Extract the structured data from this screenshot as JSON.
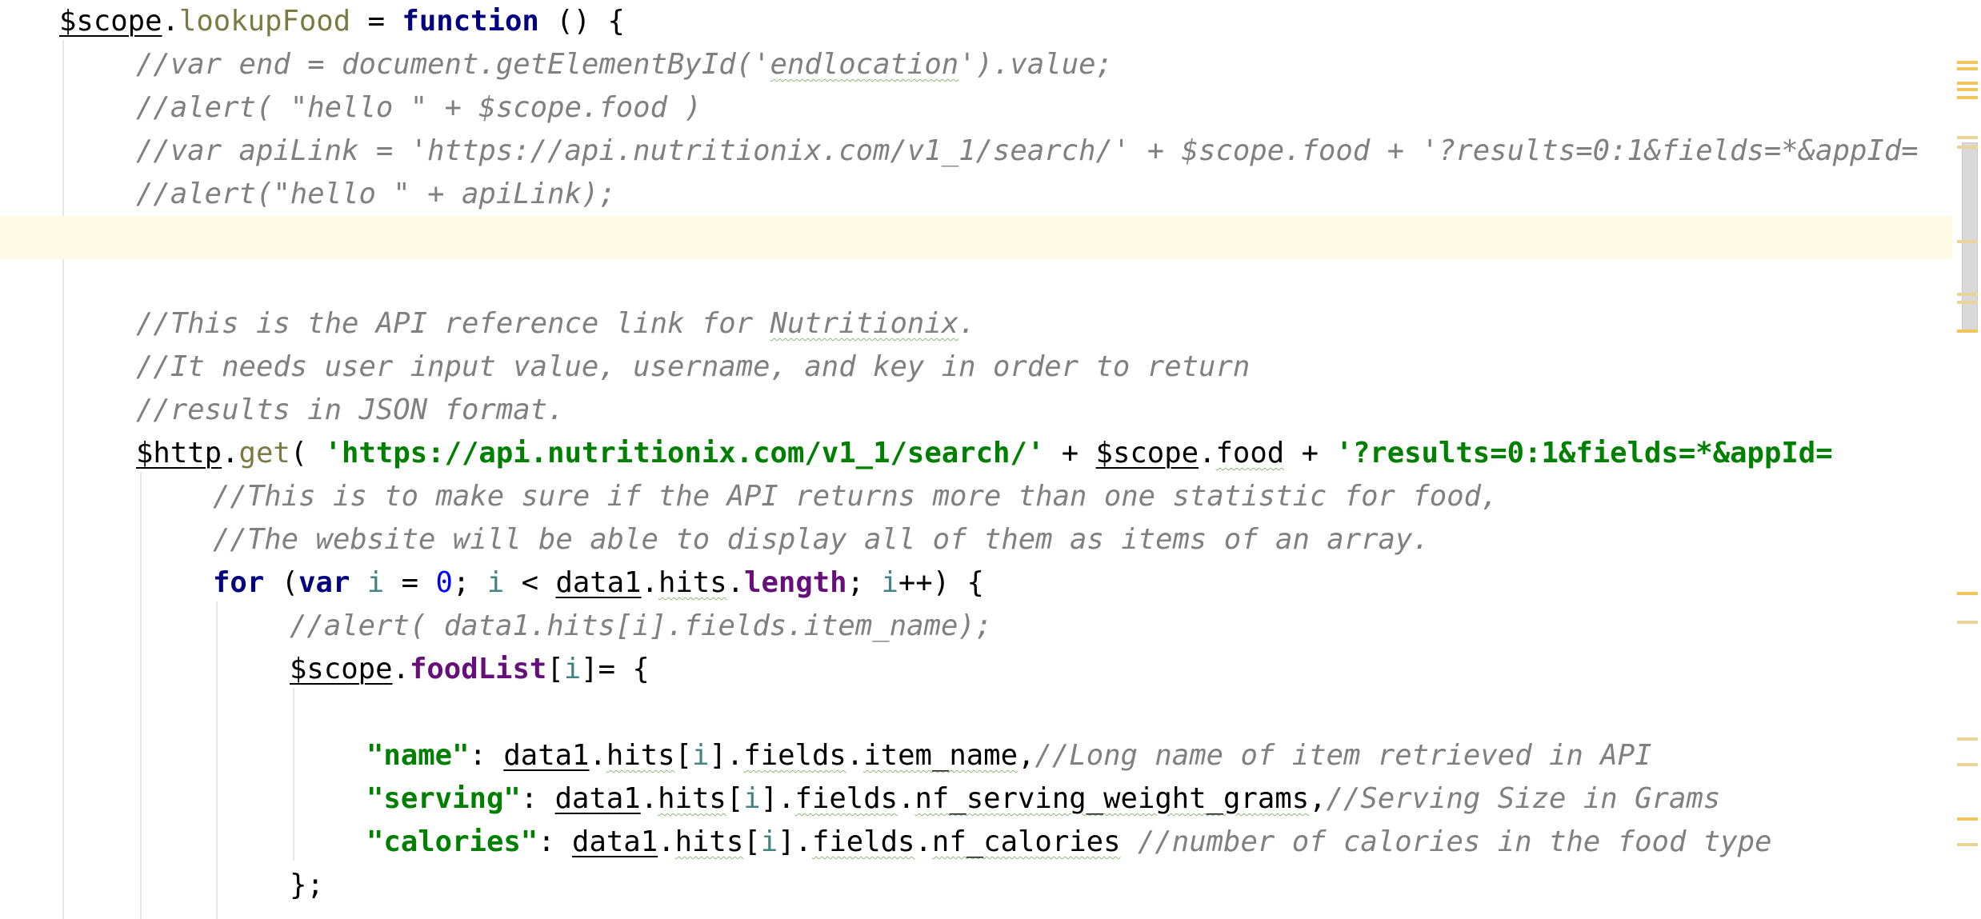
{
  "editor": {
    "colors": {
      "keyword": "#000080",
      "comment": "#808080",
      "string": "#008000",
      "function": "#7a7a43",
      "number": "#0000ff",
      "local": "#458383",
      "property": "#660e7a",
      "current_line": "#fefae4",
      "marker_warning": "#f2c55c",
      "marker_info": "#ebd49a"
    },
    "current_line_index": 5,
    "lines": [
      {
        "indent": 0,
        "tokens": [
          [
            "$scope",
            "plain u"
          ],
          [
            ".",
            "plain"
          ],
          [
            "lookupFood",
            "fn"
          ],
          [
            " = ",
            "plain"
          ],
          [
            "function",
            "kw"
          ],
          [
            " () {",
            "plain"
          ]
        ]
      },
      {
        "indent": 1,
        "tokens": [
          [
            "//var end = document.getElementById('",
            "cm"
          ],
          [
            "endlocation",
            "cm typo"
          ],
          [
            "').value;",
            "cm"
          ]
        ]
      },
      {
        "indent": 1,
        "tokens": [
          [
            "//alert( \"hello \" + $scope.food )",
            "cm"
          ]
        ]
      },
      {
        "indent": 1,
        "tokens": [
          [
            "//var apiLink = 'https://api.nutritionix.com/v1_1/search/' + $scope.food + '?results=0:1&fields=*&appId=",
            "cm"
          ]
        ]
      },
      {
        "indent": 1,
        "tokens": [
          [
            "//alert(\"hello \" + apiLink);",
            "cm"
          ]
        ]
      },
      {
        "indent": 0,
        "tokens": []
      },
      {
        "indent": 0,
        "tokens": []
      },
      {
        "indent": 1,
        "tokens": [
          [
            "//This is the API reference link for ",
            "cm"
          ],
          [
            "Nutritionix",
            "cm typo"
          ],
          [
            ".",
            "cm"
          ]
        ]
      },
      {
        "indent": 1,
        "tokens": [
          [
            "//It needs user input value, username, and key in order to return",
            "cm"
          ]
        ]
      },
      {
        "indent": 1,
        "tokens": [
          [
            "//results in JSON format.",
            "cm"
          ]
        ]
      },
      {
        "indent": 1,
        "tokens": [
          [
            "$http",
            "plain u"
          ],
          [
            ".",
            "plain"
          ],
          [
            "get",
            "fn"
          ],
          [
            "( ",
            "plain"
          ],
          [
            "'https://api.nutritionix.com/v1_1/search/'",
            "str"
          ],
          [
            " + ",
            "plain"
          ],
          [
            "$scope",
            "plain u"
          ],
          [
            ".",
            "plain"
          ],
          [
            "food",
            "plain typo"
          ],
          [
            " + ",
            "plain"
          ],
          [
            "'?results=0:1&fields=*&appId=",
            "str"
          ]
        ]
      },
      {
        "indent": 2,
        "tokens": [
          [
            "//This is to make sure if the API returns more than one statistic for food,",
            "cm"
          ]
        ]
      },
      {
        "indent": 2,
        "tokens": [
          [
            "//The website will be able to display all of them as items of an array.",
            "cm"
          ]
        ]
      },
      {
        "indent": 2,
        "tokens": [
          [
            "for",
            "kw"
          ],
          [
            " (",
            "plain"
          ],
          [
            "var",
            "kw"
          ],
          [
            " ",
            "plain"
          ],
          [
            "i",
            "loc"
          ],
          [
            " = ",
            "plain"
          ],
          [
            "0",
            "num"
          ],
          [
            "; ",
            "plain"
          ],
          [
            "i",
            "loc"
          ],
          [
            " < ",
            "plain"
          ],
          [
            "data1",
            "plain u"
          ],
          [
            ".",
            "plain"
          ],
          [
            "hits",
            "plain typo"
          ],
          [
            ".",
            "plain"
          ],
          [
            "length",
            "prop"
          ],
          [
            "; ",
            "plain"
          ],
          [
            "i",
            "loc"
          ],
          [
            "++) {",
            "plain"
          ]
        ]
      },
      {
        "indent": 3,
        "tokens": [
          [
            "//alert( data1.hits[i].fields.item_name);",
            "cm"
          ]
        ]
      },
      {
        "indent": 3,
        "tokens": [
          [
            "$scope",
            "plain u"
          ],
          [
            ".",
            "plain"
          ],
          [
            "foodList",
            "prop"
          ],
          [
            "[",
            "plain"
          ],
          [
            "i",
            "loc"
          ],
          [
            "]= {",
            "plain"
          ]
        ]
      },
      {
        "indent": 0,
        "tokens": []
      },
      {
        "indent": 4,
        "tokens": [
          [
            "\"name\"",
            "str"
          ],
          [
            ": ",
            "plain"
          ],
          [
            "data1",
            "plain u"
          ],
          [
            ".",
            "plain"
          ],
          [
            "hits",
            "plain typo"
          ],
          [
            "[",
            "plain"
          ],
          [
            "i",
            "loc"
          ],
          [
            "].",
            "plain"
          ],
          [
            "fields",
            "plain typo"
          ],
          [
            ".",
            "plain"
          ],
          [
            "item_name",
            "plain typo"
          ],
          [
            ",",
            "plain"
          ],
          [
            "//Long name of item retrieved in API",
            "cm"
          ]
        ]
      },
      {
        "indent": 4,
        "tokens": [
          [
            "\"serving\"",
            "str"
          ],
          [
            ": ",
            "plain"
          ],
          [
            "data1",
            "plain u"
          ],
          [
            ".",
            "plain"
          ],
          [
            "hits",
            "plain typo"
          ],
          [
            "[",
            "plain"
          ],
          [
            "i",
            "loc"
          ],
          [
            "].",
            "plain"
          ],
          [
            "fields",
            "plain typo"
          ],
          [
            ".",
            "plain"
          ],
          [
            "nf_serving_weight_grams",
            "plain typo"
          ],
          [
            ",",
            "plain"
          ],
          [
            "//Serving Size in Grams",
            "cm"
          ]
        ]
      },
      {
        "indent": 4,
        "tokens": [
          [
            "\"calories\"",
            "str"
          ],
          [
            ": ",
            "plain"
          ],
          [
            "data1",
            "plain u"
          ],
          [
            ".",
            "plain"
          ],
          [
            "hits",
            "plain typo"
          ],
          [
            "[",
            "plain"
          ],
          [
            "i",
            "loc"
          ],
          [
            "].",
            "plain"
          ],
          [
            "fields",
            "plain typo"
          ],
          [
            ".",
            "plain"
          ],
          [
            "nf_calories",
            "plain typo"
          ],
          [
            " ",
            "plain"
          ],
          [
            "//number of calories in the food type",
            "cm"
          ]
        ]
      },
      {
        "indent": 3,
        "tokens": [
          [
            "};",
            "plain"
          ]
        ]
      }
    ]
  }
}
